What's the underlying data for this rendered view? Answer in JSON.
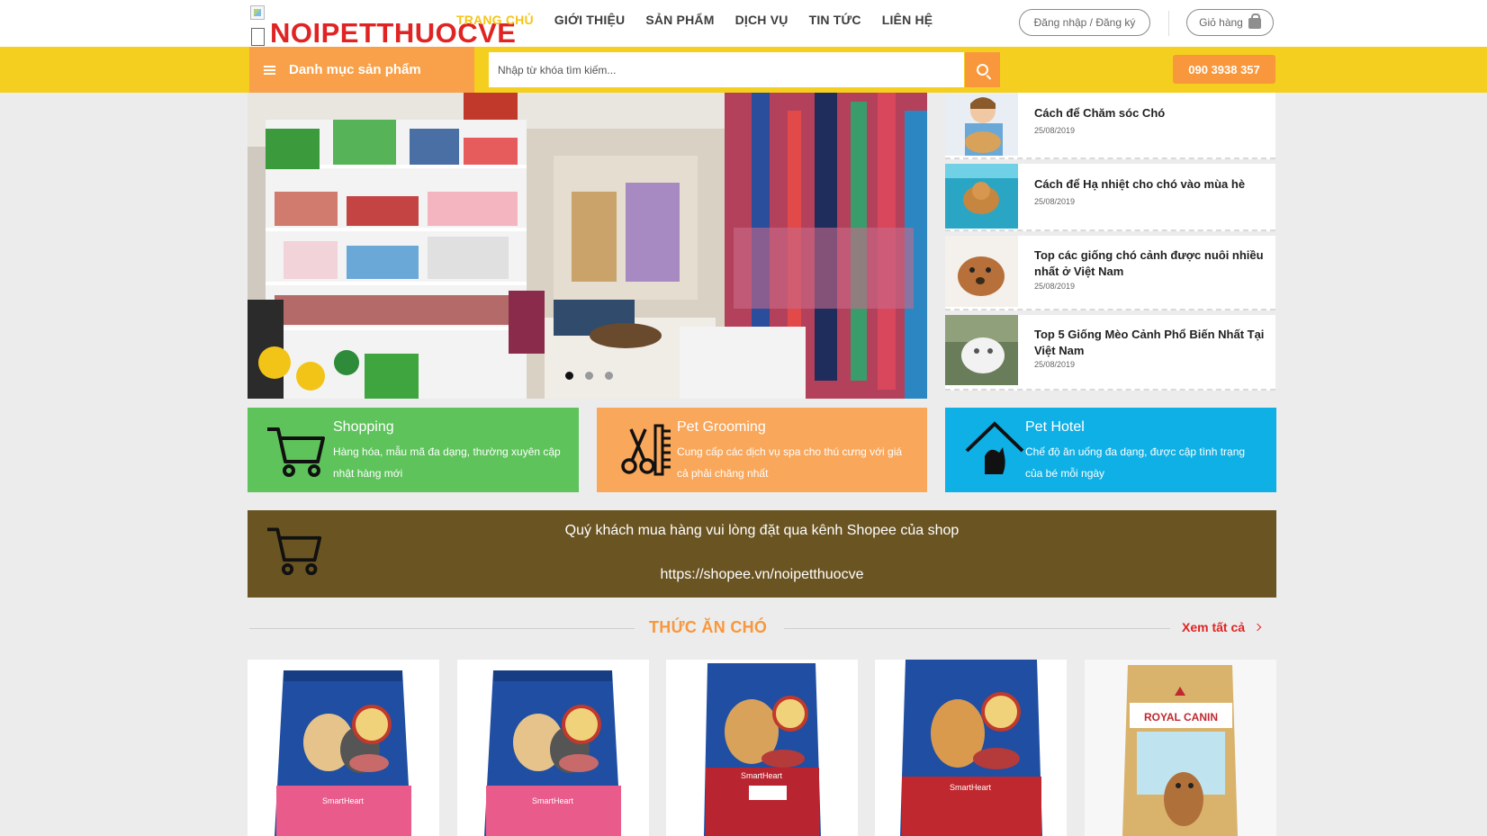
{
  "header": {
    "logo_text": "NOIPETTHUOCVE",
    "nav": [
      "TRANG CHỦ",
      "GIỚI THIỆU",
      "SẢN PHẨM",
      "DỊCH VỤ",
      "TIN TỨC",
      "LIÊN HỆ"
    ],
    "active_nav": "TRANG CHỦ",
    "login_label": "Đăng nhập / Đăng ký",
    "cart_label": "Giỏ hàng",
    "cart_icon": "shopping-bag-icon"
  },
  "toolbar": {
    "category_label": "Danh mục sản phẩm",
    "category_icon": "hamburger-icon",
    "search_placeholder": "Nhập từ khóa tìm kiếm...",
    "search_icon": "search-icon",
    "hotline": "090 3938 357"
  },
  "slider": {
    "slide_count": 3,
    "active_slide": 1
  },
  "news": [
    {
      "title": "Cách để Chăm sóc Chó",
      "date": "25/08/2019"
    },
    {
      "title": "Cách để Hạ nhiệt cho chó vào mùa hè",
      "date": "25/08/2019"
    },
    {
      "title": "Top các giống chó cảnh được nuôi nhiều nhất ở Việt Nam",
      "date": "25/08/2019"
    },
    {
      "title": "Top 5 Giống Mèo Cảnh Phổ Biến Nhất Tại Việt Nam",
      "date": "25/08/2019"
    }
  ],
  "services": [
    {
      "title": "Shopping",
      "desc": "Hàng hóa, mẫu mã đa dạng, thường xuyên cập nhật hàng mới",
      "icon": "cart-icon",
      "color": "#5ec35b"
    },
    {
      "title": "Pet Grooming",
      "desc": "Cung cấp các dịch vụ spa cho thú cưng với giá cả phải chăng nhất",
      "icon": "scissors-comb-icon",
      "color": "#f9a75a"
    },
    {
      "title": "Pet Hotel",
      "desc": "Chế độ ăn uống đa dạng, được cập tình trạng của bé mỗi ngày",
      "icon": "dog-house-icon",
      "color": "#0eb0e6"
    }
  ],
  "banner": {
    "line1": "Quý khách mua hàng vui lòng đặt qua kênh Shopee của shop",
    "line2": "https://shopee.vn/noipetthuocve",
    "icon": "cart-icon",
    "color": "#6a5422"
  },
  "section": {
    "title": "THỨC ĂN CHÓ",
    "see_all": "Xem tất cả",
    "see_all_icon": "chevron-right-icon"
  },
  "products": [
    {
      "brand_text": "SmartHeart",
      "image_label": "dog-food-bag-puppy"
    },
    {
      "brand_text": "SmartHeart",
      "image_label": "dog-food-bag-puppy"
    },
    {
      "brand_text": "SmartHeart",
      "image_label": "dog-food-bag-adult"
    },
    {
      "brand_text": "SmartHeart",
      "image_label": "dog-food-bag-adult"
    },
    {
      "brand_text": "ROYAL CANIN",
      "image_label": "dog-food-bag-royal-canin"
    }
  ],
  "colors": {
    "accent_yellow": "#f5cf1f",
    "accent_orange": "#f8973b",
    "logo_red": "#e02424"
  }
}
